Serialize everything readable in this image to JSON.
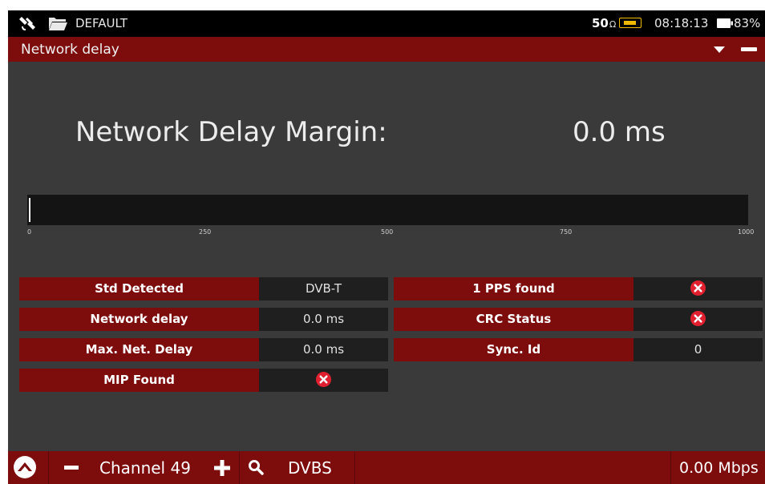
{
  "status_bar": {
    "profile_name": "DEFAULT",
    "impedance": "50",
    "impedance_unit": "Ω",
    "lnb_icon": "lnb-voltage-icon",
    "time": "08:18:13",
    "battery": "83%"
  },
  "title_bar": {
    "title": "Network delay"
  },
  "main": {
    "margin_label": "Network Delay Margin:",
    "margin_value": "0.0 ms",
    "scale_labels": [
      "0",
      "250",
      "500",
      "750",
      "1000"
    ],
    "bar_level_fraction": 0.0
  },
  "params_left": [
    {
      "label": "Std Detected",
      "value": "DVB-T"
    },
    {
      "label": "Network delay",
      "value": "0.0 ms"
    },
    {
      "label": "Max. Net. Delay",
      "value": "0.0 ms"
    },
    {
      "label": "MIP Found",
      "value": "",
      "icon": "error-x-icon"
    }
  ],
  "params_right": [
    {
      "label": "1 PPS found",
      "value": "",
      "icon": "error-x-icon"
    },
    {
      "label": "CRC Status",
      "value": "",
      "icon": "error-x-icon"
    },
    {
      "label": "Sync. Id",
      "value": "0"
    }
  ],
  "bottom_bar": {
    "channel": "Channel 49",
    "standard": "DVBS",
    "bitrate": "0.00 Mbps"
  },
  "colors": {
    "accent_red": "#7d0c0c",
    "background": "#3a3a3a",
    "error_icon": "#e0202e"
  }
}
